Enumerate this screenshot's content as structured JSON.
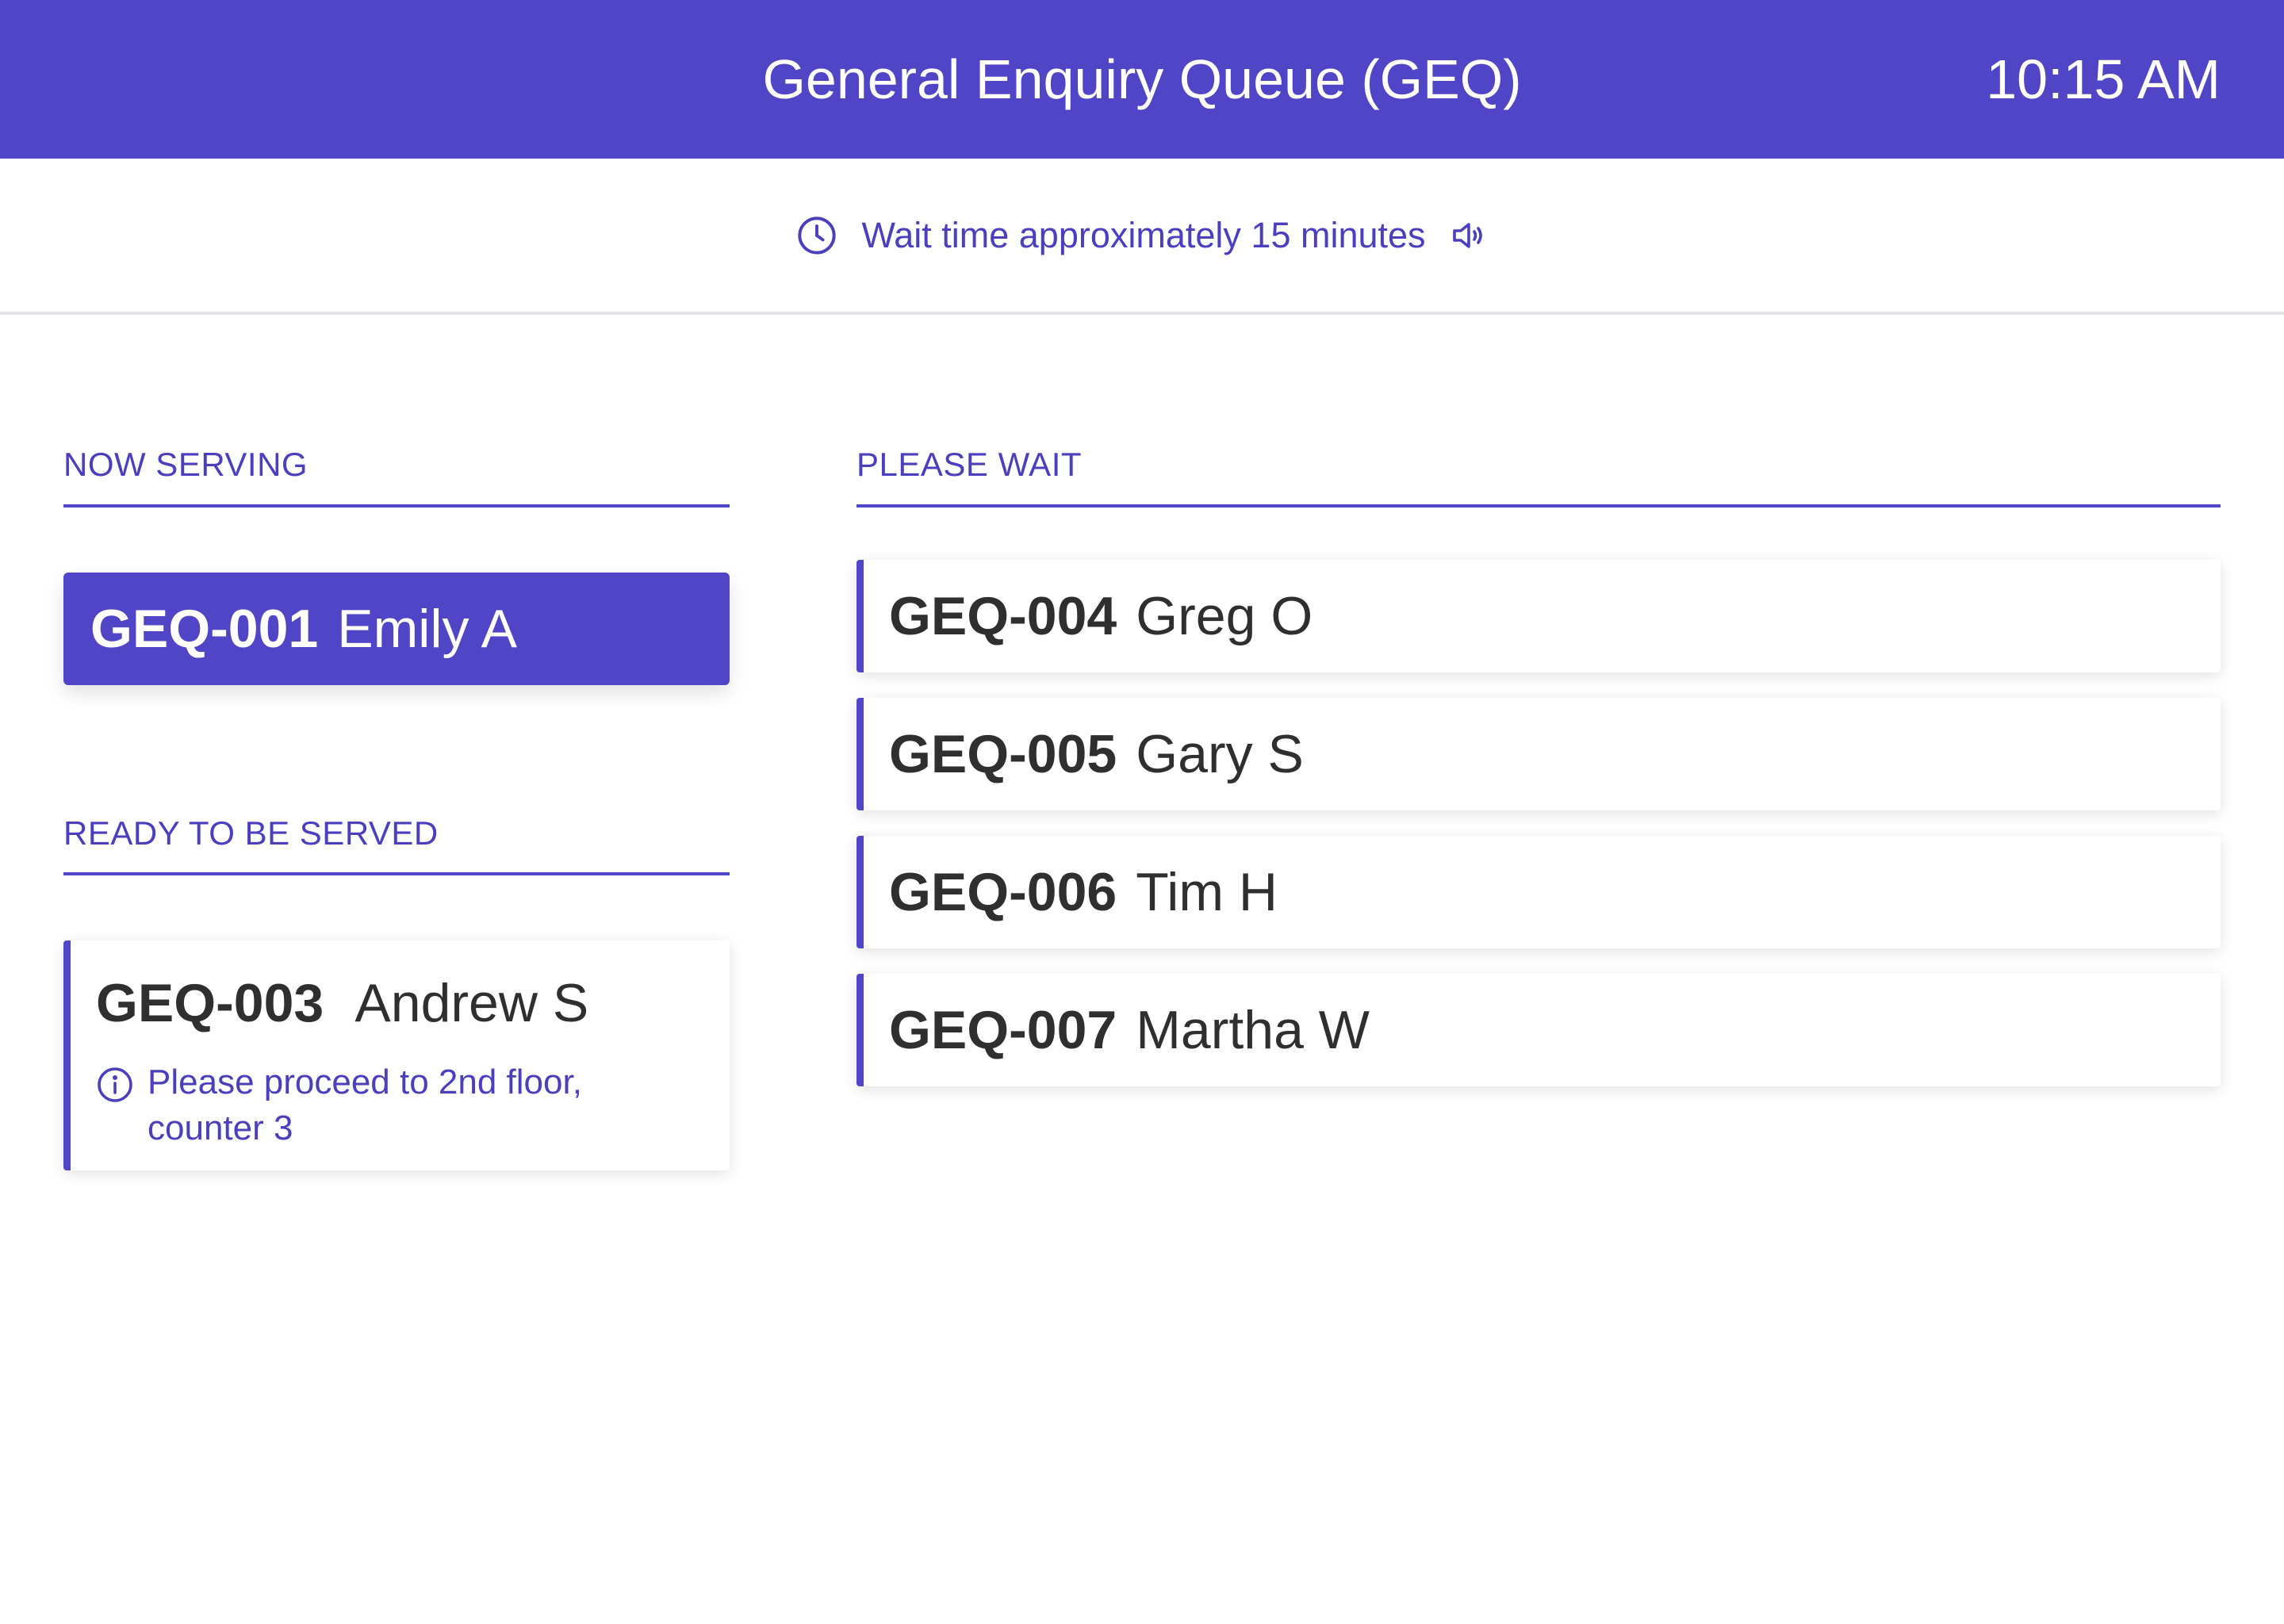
{
  "header": {
    "title": "General Enquiry Queue (GEQ)",
    "time": "10:15 AM"
  },
  "info_bar": {
    "wait_text": "Wait time approximately 15 minutes",
    "clock_icon": "clock-icon",
    "speaker_icon": "speaker-icon"
  },
  "now_serving": {
    "label": "NOW SERVING",
    "ticket": {
      "code": "GEQ-001",
      "name": "Emily A"
    }
  },
  "ready": {
    "label": "READY TO BE SERVED",
    "ticket": {
      "code": "GEQ-003",
      "name": "Andrew S",
      "message": "Please proceed to 2nd floor, counter 3",
      "info_icon": "info-icon"
    }
  },
  "please_wait": {
    "label": "PLEASE WAIT",
    "tickets": [
      {
        "code": "GEQ-004",
        "name": "Greg O"
      },
      {
        "code": "GEQ-005",
        "name": "Gary S"
      },
      {
        "code": "GEQ-006",
        "name": "Tim H"
      },
      {
        "code": "GEQ-007",
        "name": "Martha W"
      }
    ]
  },
  "colors": {
    "accent": "#5145c7",
    "accent_text": "#4b3fbf",
    "card_text": "#2f2f2f"
  }
}
